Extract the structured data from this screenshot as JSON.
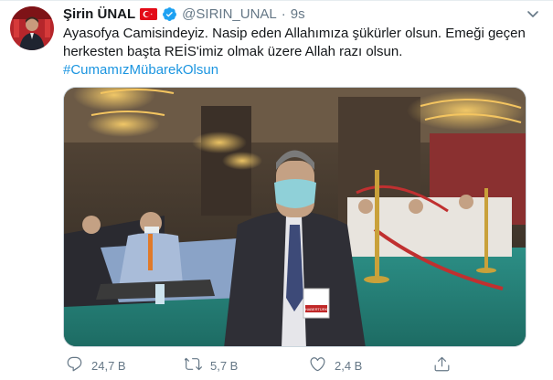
{
  "tweet": {
    "author_name": "Şirin ÜNAL",
    "handle": "@SIRIN_UNAL",
    "separator": "·",
    "time": "9s",
    "text": "Ayasofya Camisindeyiz. Nasip eden Allahımıza şükürler olsun. Emeği geçen herkesten başta REİS'imiz olmak üzere Allah razı olsun.",
    "hashtag": "#CumamızMübarekOlsun",
    "media_alt": "",
    "media_sign_text": "HABERTÜRK"
  },
  "actions": {
    "reply_count": "24,7 B",
    "retweet_count": "5,7 B",
    "like_count": "2,4 B"
  },
  "icons": {
    "flag": "turkey-flag-icon",
    "verified": "verified-badge-icon",
    "more": "chevron-down-icon",
    "reply": "reply-icon",
    "retweet": "retweet-icon",
    "like": "heart-icon",
    "share": "share-icon"
  },
  "colors": {
    "text": "#14171a",
    "secondary": "#657786",
    "link": "#1b95e0",
    "verified": "#1da1f2",
    "flag": "#e30a17"
  }
}
